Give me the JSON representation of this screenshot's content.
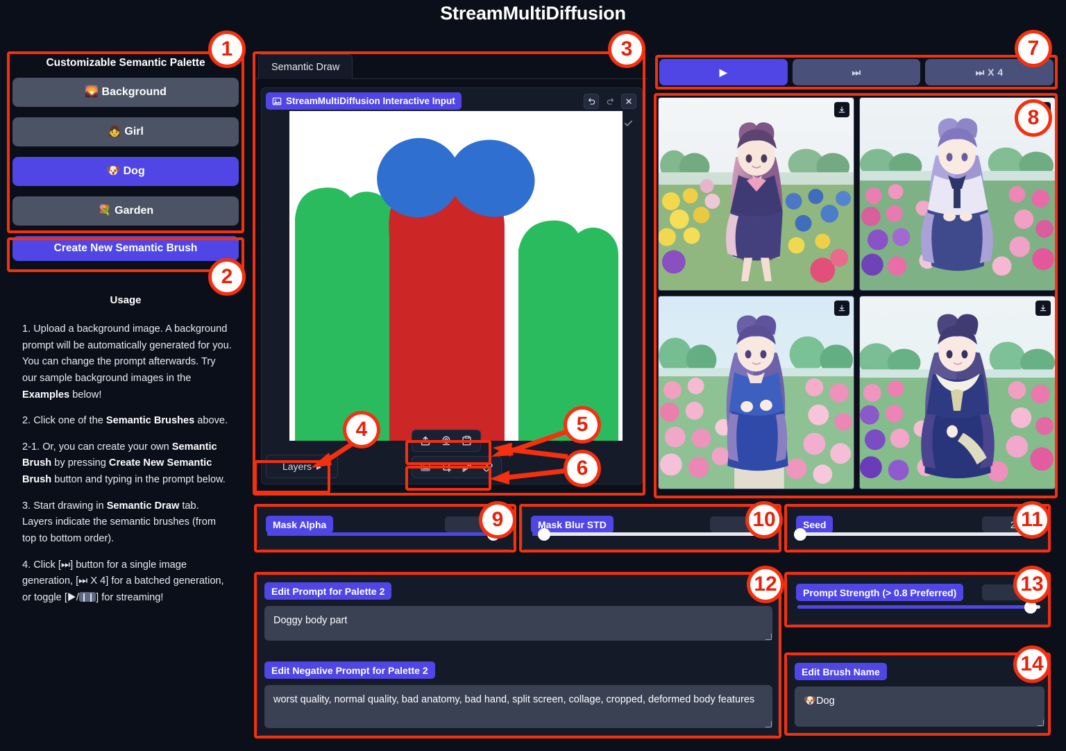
{
  "app": {
    "title": "StreamMultiDiffusion"
  },
  "sidebar": {
    "palette_title": "Customizable Semantic Palette",
    "brushes": [
      {
        "label": "Background",
        "emoji": "🌄",
        "active": false
      },
      {
        "label": "Girl",
        "emoji": "👧",
        "active": false
      },
      {
        "label": "Dog",
        "emoji": "🐶",
        "active": true
      },
      {
        "label": "Garden",
        "emoji": "💐",
        "active": false
      }
    ],
    "create_button": "Create New Semantic Brush",
    "usage_title": "Usage",
    "usage": [
      "1. Upload a background image. A background prompt will be automatically generated for you. You can change the prompt afterwards. Try our sample background images in the Examples below!",
      "2. Click one of the Semantic Brushes above.",
      "2-1. Or, you can create your own Semantic Brush by pressing Create New Semantic Brush button and typing in the prompt below.",
      "3. Start drawing in Semantic Draw tab. Layers indicate the semantic brushes (from top to bottom order).",
      "4. Click [⏭] button for a single image generation, [⏭ X 4] for a batched generation, or toggle [▶/⏸] for streaming!"
    ]
  },
  "center": {
    "tab_label": "Semantic Draw",
    "interface_label": "StreamMultiDiffusion Interactive Input",
    "interface_icon": "image-icon",
    "window_buttons": [
      {
        "name": "undo-button",
        "glyph": "↺"
      },
      {
        "name": "redo-button",
        "glyph": "↻"
      },
      {
        "name": "close-button",
        "glyph": "✕"
      }
    ],
    "confirm_glyph": "✓",
    "layers_label": "Layers",
    "layers_chevron": "▸",
    "source_tools": [
      {
        "name": "upload-icon",
        "title": "Upload"
      },
      {
        "name": "webcam-icon",
        "title": "Webcam"
      },
      {
        "name": "paste-icon",
        "title": "Paste"
      }
    ],
    "edit_tools": [
      {
        "name": "image-tool-icon",
        "title": "Image"
      },
      {
        "name": "crop-icon",
        "title": "Crop"
      },
      {
        "name": "brush-icon",
        "title": "Draw"
      },
      {
        "name": "eraser-icon",
        "title": "Erase"
      }
    ],
    "canvas_drawing": {
      "background": "#ffffff",
      "shapes": [
        {
          "name": "garden-left-blob",
          "color": "#2bbb5f"
        },
        {
          "name": "garden-right-blob",
          "color": "#2bbb5f"
        },
        {
          "name": "dog-body-blob",
          "color": "#cc2626"
        },
        {
          "name": "dog-ear-left",
          "color": "#2f6fd0"
        },
        {
          "name": "dog-ear-right",
          "color": "#2f6fd0"
        }
      ]
    }
  },
  "run_controls": [
    {
      "name": "stream-toggle-button",
      "glyph": "▶",
      "primary": true
    },
    {
      "name": "single-generate-button",
      "glyph": "⏭",
      "primary": false
    },
    {
      "name": "batch-generate-button",
      "glyph": "⏭ X 4",
      "primary": false
    }
  ],
  "gallery": {
    "download_glyph": "⬇",
    "items": [
      {
        "name": "result-image-1",
        "alt": "anime girl with animal ears in a yellow and pink flower field"
      },
      {
        "name": "result-image-2",
        "alt": "anime girl in white and blue sailor uniform in a pink flower field"
      },
      {
        "name": "result-image-3",
        "alt": "anime girl in blue school uniform in a rose garden path"
      },
      {
        "name": "result-image-4",
        "alt": "anime girl in navy dress with white collar in a flower field"
      }
    ]
  },
  "sliders": [
    {
      "name": "mask-alpha-slider",
      "label": "Mask Alpha",
      "value": "1",
      "fill_pct": 96,
      "filled": true
    },
    {
      "name": "mask-blur-std-slider",
      "label": "Mask Blur STD",
      "value": "8",
      "fill_pct": 5,
      "filled": true
    },
    {
      "name": "seed-slider",
      "label": "Seed",
      "value": "2024",
      "fill_pct": 1,
      "filled": false
    },
    {
      "name": "prompt-strength-slider",
      "label": "Prompt Strength (> 0.8 Preferred)",
      "value": "1",
      "fill_pct": 96,
      "filled": true
    }
  ],
  "prompts": {
    "positive_label": "Edit Prompt for Palette 2",
    "positive_value": "Doggy body part",
    "negative_label": "Edit Negative Prompt for Palette 2",
    "negative_value": "worst quality, normal quality, bad anatomy, bad hand, split screen, collage, cropped, deformed body features",
    "brush_name_label": "Edit Brush Name",
    "brush_name_value": "🐶Dog"
  },
  "annotations": {
    "badges": [
      "1",
      "2",
      "3",
      "4",
      "5",
      "6",
      "7",
      "8",
      "9",
      "10",
      "11",
      "12",
      "13",
      "14"
    ],
    "accent_color": "#f5300f"
  },
  "colors": {
    "background": "#0b0f19",
    "panel": "#141a28",
    "accent_purple": "#4f46e5",
    "annotation_red": "#f5300f"
  }
}
